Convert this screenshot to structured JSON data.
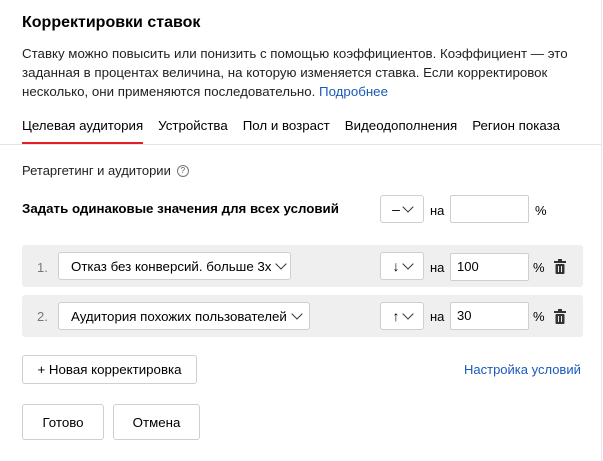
{
  "modal": {
    "title": "Корректировки ставок",
    "description": "Ставку можно повысить или понизить с помощью коэффициентов. Коэффициент — это заданная в процентах величина, на которую изменяется ставка. Если корректировок несколько, они применяются последовательно.",
    "more_link": "Подробнее"
  },
  "tabs": [
    {
      "label": "Целевая аудитория",
      "active": true
    },
    {
      "label": "Устройства",
      "active": false
    },
    {
      "label": "Пол и возраст",
      "active": false
    },
    {
      "label": "Видеодополнения",
      "active": false
    },
    {
      "label": "Регион показа",
      "active": false
    }
  ],
  "section": {
    "title": "Ретаргетинг и аудитории",
    "help_icon": "?"
  },
  "common": {
    "label": "Задать одинаковые значения для всех условий",
    "sign": "–",
    "on_label": "на",
    "value": "",
    "percent": "%"
  },
  "adjustments": [
    {
      "number": "1.",
      "condition": "Отказ без конверсий. больше 3х",
      "direction": "↓",
      "on_label": "на",
      "value": "100",
      "percent": "%"
    },
    {
      "number": "2.",
      "condition": "Аудитория похожих пользователей",
      "direction": "↑",
      "on_label": "на",
      "value": "30",
      "percent": "%"
    }
  ],
  "actions": {
    "add_label": "+ Новая корректировка",
    "settings_link": "Настройка условий",
    "done_label": "Готово",
    "cancel_label": "Отмена"
  },
  "colors": {
    "accent_red": "#e31e24",
    "link_blue": "#1a5ab8",
    "row_bg": "#efefef"
  }
}
